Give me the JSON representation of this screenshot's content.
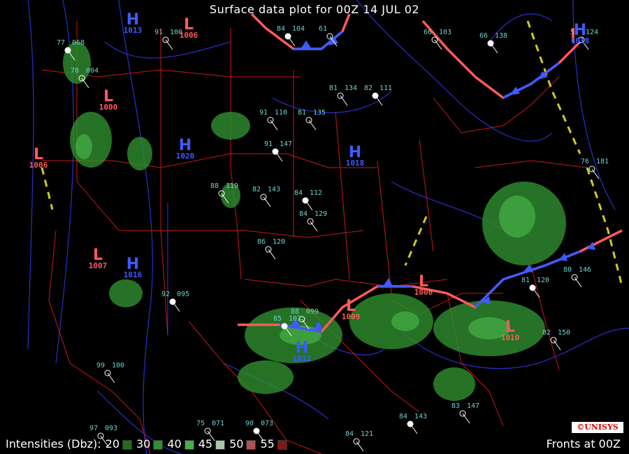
{
  "title": "Surface data plot for 00Z 14 JUL 02",
  "legend": {
    "label": "Intensities (Dbz):",
    "levels": [
      {
        "dbz": "20",
        "color": "#1e6e1e"
      },
      {
        "dbz": "30",
        "color": "#2f8f2f"
      },
      {
        "dbz": "40",
        "color": "#46b046"
      },
      {
        "dbz": "45",
        "color": "#a8c8a8"
      },
      {
        "dbz": "50",
        "color": "#b05050"
      },
      {
        "dbz": "55",
        "color": "#801818"
      }
    ]
  },
  "fronts_label": "Fronts at 00Z",
  "credit": "©UNISYS",
  "colors": {
    "cold_front": "#3d5bff",
    "warm_front": "#ff5a5a",
    "isobar": "#2830c8",
    "border": "#c81818",
    "station": "#6fd0d0",
    "trough": "#cccc22"
  },
  "pressure_centers": [
    {
      "type": "H",
      "value": "1013",
      "color": "blue"
    },
    {
      "type": "L",
      "value": "1006",
      "color": "red"
    },
    {
      "type": "L",
      "value": "1000",
      "color": "red"
    },
    {
      "type": "H",
      "value": "1020",
      "color": "blue"
    },
    {
      "type": "L",
      "value": "1006",
      "color": "red"
    },
    {
      "type": "H",
      "value": "1018",
      "color": "blue"
    },
    {
      "type": "L",
      "value": "1007",
      "color": "red"
    },
    {
      "type": "H",
      "value": "1016",
      "color": "blue"
    },
    {
      "type": "L",
      "value": "1009",
      "color": "red"
    },
    {
      "type": "L",
      "value": "1006",
      "color": "red"
    },
    {
      "type": "H",
      "value": "1012",
      "color": "blue"
    },
    {
      "type": "L",
      "value": "1010",
      "color": "red"
    },
    {
      "type": "H",
      "value": "1018",
      "color": "blue"
    }
  ],
  "stations": [
    {
      "temp": "77",
      "press": "068"
    },
    {
      "temp": "78",
      "press": "004"
    },
    {
      "temp": "91",
      "press": "100"
    },
    {
      "temp": "84",
      "press": "104"
    },
    {
      "temp": "61",
      "press": ""
    },
    {
      "temp": "66",
      "press": "103"
    },
    {
      "temp": "66",
      "press": "138"
    },
    {
      "temp": "55",
      "press": "124"
    },
    {
      "temp": "81",
      "press": "134"
    },
    {
      "temp": "82",
      "press": "111"
    },
    {
      "temp": "91",
      "press": "110"
    },
    {
      "temp": "81",
      "press": "135"
    },
    {
      "temp": "91",
      "press": "147"
    },
    {
      "temp": "88",
      "press": "119"
    },
    {
      "temp": "82",
      "press": "143"
    },
    {
      "temp": "84",
      "press": "112"
    },
    {
      "temp": "86",
      "press": "120"
    },
    {
      "temp": "84",
      "press": "129"
    },
    {
      "temp": "92",
      "press": "095"
    },
    {
      "temp": "99",
      "press": "100"
    },
    {
      "temp": "88",
      "press": "099"
    },
    {
      "temp": "85",
      "press": "103"
    },
    {
      "temp": "82",
      "press": "150"
    },
    {
      "temp": "80",
      "press": "146"
    },
    {
      "temp": "84",
      "press": "143"
    },
    {
      "temp": "83",
      "press": "147"
    },
    {
      "temp": "76",
      "press": "181"
    },
    {
      "temp": "81",
      "press": "120"
    },
    {
      "temp": "97",
      "press": "093"
    },
    {
      "temp": "75",
      "press": "071"
    },
    {
      "temp": "90",
      "press": "073"
    },
    {
      "temp": "84",
      "press": "121"
    }
  ]
}
